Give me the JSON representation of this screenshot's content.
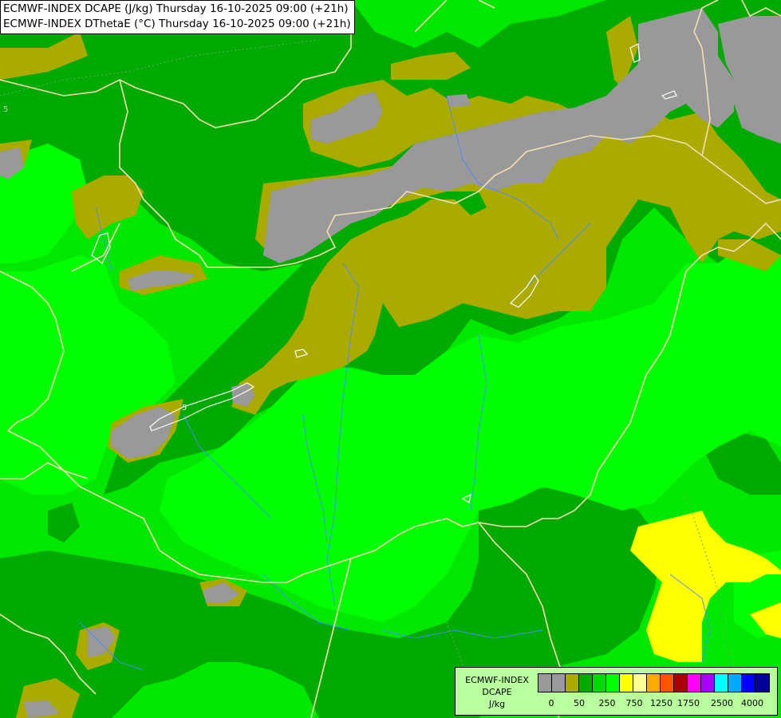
{
  "header": {
    "line1": "ECMWF-INDEX DCAPE (J/kg) Thursday 16-10-2025 09:00 (+21h)",
    "line2": "ECMWF-INDEX DThetaE (°C) Thursday 16-10-2025 09:00 (+21h)"
  },
  "map": {
    "contour_labels": [
      "5",
      "5"
    ],
    "colors": {
      "gray": "#999999",
      "olive": "#aaaa00",
      "dark_green": "#00aa00",
      "green": "#00d900",
      "bright_green": "#00ff00",
      "yellow": "#ffff00",
      "border": "#f5deb3",
      "river": "#4c8aff"
    }
  },
  "legend": {
    "title1": "ECMWF-INDEX",
    "title2": "DCAPE",
    "unit": "J/kg",
    "swatch_colors": [
      "#999999",
      "#999999",
      "#aaaa00",
      "#00aa00",
      "#00d900",
      "#00ff00",
      "#ffff00",
      "#ffff99",
      "#ffaa00",
      "#ff5500",
      "#aa0000",
      "#ff00ff",
      "#aa00ff",
      "#00ffff",
      "#00aaff",
      "#0000ff",
      "#000099"
    ],
    "ticks": [
      "0",
      "50",
      "250",
      "750",
      "1250",
      "1750",
      "2500",
      "4000"
    ]
  }
}
